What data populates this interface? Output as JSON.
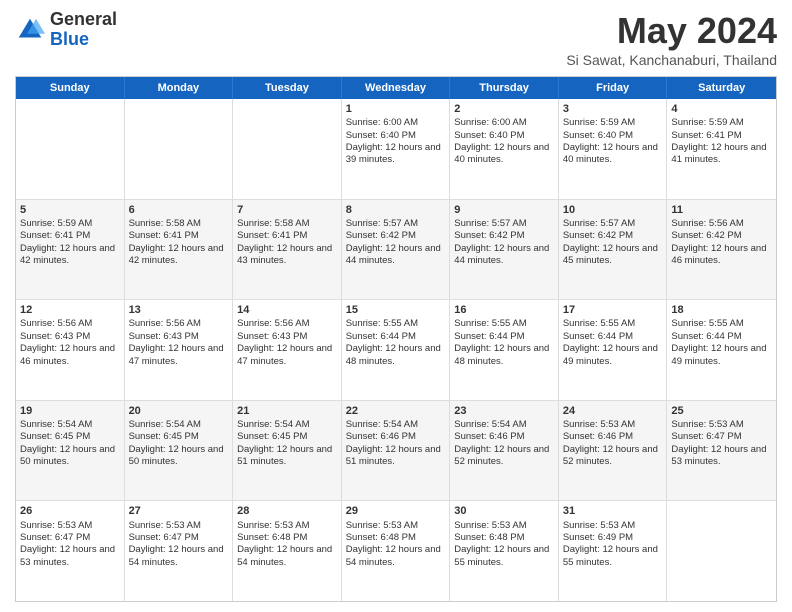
{
  "header": {
    "logo": {
      "line1": "General",
      "line2": "Blue"
    },
    "title": "May 2024",
    "subtitle": "Si Sawat, Kanchanaburi, Thailand"
  },
  "weekdays": [
    "Sunday",
    "Monday",
    "Tuesday",
    "Wednesday",
    "Thursday",
    "Friday",
    "Saturday"
  ],
  "rows": [
    {
      "alt": false,
      "cells": [
        {
          "day": "",
          "sunrise": "",
          "sunset": "",
          "daylight": ""
        },
        {
          "day": "",
          "sunrise": "",
          "sunset": "",
          "daylight": ""
        },
        {
          "day": "",
          "sunrise": "",
          "sunset": "",
          "daylight": ""
        },
        {
          "day": "1",
          "sunrise": "Sunrise: 6:00 AM",
          "sunset": "Sunset: 6:40 PM",
          "daylight": "Daylight: 12 hours and 39 minutes."
        },
        {
          "day": "2",
          "sunrise": "Sunrise: 6:00 AM",
          "sunset": "Sunset: 6:40 PM",
          "daylight": "Daylight: 12 hours and 40 minutes."
        },
        {
          "day": "3",
          "sunrise": "Sunrise: 5:59 AM",
          "sunset": "Sunset: 6:40 PM",
          "daylight": "Daylight: 12 hours and 40 minutes."
        },
        {
          "day": "4",
          "sunrise": "Sunrise: 5:59 AM",
          "sunset": "Sunset: 6:41 PM",
          "daylight": "Daylight: 12 hours and 41 minutes."
        }
      ]
    },
    {
      "alt": true,
      "cells": [
        {
          "day": "5",
          "sunrise": "Sunrise: 5:59 AM",
          "sunset": "Sunset: 6:41 PM",
          "daylight": "Daylight: 12 hours and 42 minutes."
        },
        {
          "day": "6",
          "sunrise": "Sunrise: 5:58 AM",
          "sunset": "Sunset: 6:41 PM",
          "daylight": "Daylight: 12 hours and 42 minutes."
        },
        {
          "day": "7",
          "sunrise": "Sunrise: 5:58 AM",
          "sunset": "Sunset: 6:41 PM",
          "daylight": "Daylight: 12 hours and 43 minutes."
        },
        {
          "day": "8",
          "sunrise": "Sunrise: 5:57 AM",
          "sunset": "Sunset: 6:42 PM",
          "daylight": "Daylight: 12 hours and 44 minutes."
        },
        {
          "day": "9",
          "sunrise": "Sunrise: 5:57 AM",
          "sunset": "Sunset: 6:42 PM",
          "daylight": "Daylight: 12 hours and 44 minutes."
        },
        {
          "day": "10",
          "sunrise": "Sunrise: 5:57 AM",
          "sunset": "Sunset: 6:42 PM",
          "daylight": "Daylight: 12 hours and 45 minutes."
        },
        {
          "day": "11",
          "sunrise": "Sunrise: 5:56 AM",
          "sunset": "Sunset: 6:42 PM",
          "daylight": "Daylight: 12 hours and 46 minutes."
        }
      ]
    },
    {
      "alt": false,
      "cells": [
        {
          "day": "12",
          "sunrise": "Sunrise: 5:56 AM",
          "sunset": "Sunset: 6:43 PM",
          "daylight": "Daylight: 12 hours and 46 minutes."
        },
        {
          "day": "13",
          "sunrise": "Sunrise: 5:56 AM",
          "sunset": "Sunset: 6:43 PM",
          "daylight": "Daylight: 12 hours and 47 minutes."
        },
        {
          "day": "14",
          "sunrise": "Sunrise: 5:56 AM",
          "sunset": "Sunset: 6:43 PM",
          "daylight": "Daylight: 12 hours and 47 minutes."
        },
        {
          "day": "15",
          "sunrise": "Sunrise: 5:55 AM",
          "sunset": "Sunset: 6:44 PM",
          "daylight": "Daylight: 12 hours and 48 minutes."
        },
        {
          "day": "16",
          "sunrise": "Sunrise: 5:55 AM",
          "sunset": "Sunset: 6:44 PM",
          "daylight": "Daylight: 12 hours and 48 minutes."
        },
        {
          "day": "17",
          "sunrise": "Sunrise: 5:55 AM",
          "sunset": "Sunset: 6:44 PM",
          "daylight": "Daylight: 12 hours and 49 minutes."
        },
        {
          "day": "18",
          "sunrise": "Sunrise: 5:55 AM",
          "sunset": "Sunset: 6:44 PM",
          "daylight": "Daylight: 12 hours and 49 minutes."
        }
      ]
    },
    {
      "alt": true,
      "cells": [
        {
          "day": "19",
          "sunrise": "Sunrise: 5:54 AM",
          "sunset": "Sunset: 6:45 PM",
          "daylight": "Daylight: 12 hours and 50 minutes."
        },
        {
          "day": "20",
          "sunrise": "Sunrise: 5:54 AM",
          "sunset": "Sunset: 6:45 PM",
          "daylight": "Daylight: 12 hours and 50 minutes."
        },
        {
          "day": "21",
          "sunrise": "Sunrise: 5:54 AM",
          "sunset": "Sunset: 6:45 PM",
          "daylight": "Daylight: 12 hours and 51 minutes."
        },
        {
          "day": "22",
          "sunrise": "Sunrise: 5:54 AM",
          "sunset": "Sunset: 6:46 PM",
          "daylight": "Daylight: 12 hours and 51 minutes."
        },
        {
          "day": "23",
          "sunrise": "Sunrise: 5:54 AM",
          "sunset": "Sunset: 6:46 PM",
          "daylight": "Daylight: 12 hours and 52 minutes."
        },
        {
          "day": "24",
          "sunrise": "Sunrise: 5:53 AM",
          "sunset": "Sunset: 6:46 PM",
          "daylight": "Daylight: 12 hours and 52 minutes."
        },
        {
          "day": "25",
          "sunrise": "Sunrise: 5:53 AM",
          "sunset": "Sunset: 6:47 PM",
          "daylight": "Daylight: 12 hours and 53 minutes."
        }
      ]
    },
    {
      "alt": false,
      "cells": [
        {
          "day": "26",
          "sunrise": "Sunrise: 5:53 AM",
          "sunset": "Sunset: 6:47 PM",
          "daylight": "Daylight: 12 hours and 53 minutes."
        },
        {
          "day": "27",
          "sunrise": "Sunrise: 5:53 AM",
          "sunset": "Sunset: 6:47 PM",
          "daylight": "Daylight: 12 hours and 54 minutes."
        },
        {
          "day": "28",
          "sunrise": "Sunrise: 5:53 AM",
          "sunset": "Sunset: 6:48 PM",
          "daylight": "Daylight: 12 hours and 54 minutes."
        },
        {
          "day": "29",
          "sunrise": "Sunrise: 5:53 AM",
          "sunset": "Sunset: 6:48 PM",
          "daylight": "Daylight: 12 hours and 54 minutes."
        },
        {
          "day": "30",
          "sunrise": "Sunrise: 5:53 AM",
          "sunset": "Sunset: 6:48 PM",
          "daylight": "Daylight: 12 hours and 55 minutes."
        },
        {
          "day": "31",
          "sunrise": "Sunrise: 5:53 AM",
          "sunset": "Sunset: 6:49 PM",
          "daylight": "Daylight: 12 hours and 55 minutes."
        },
        {
          "day": "",
          "sunrise": "",
          "sunset": "",
          "daylight": ""
        }
      ]
    }
  ]
}
